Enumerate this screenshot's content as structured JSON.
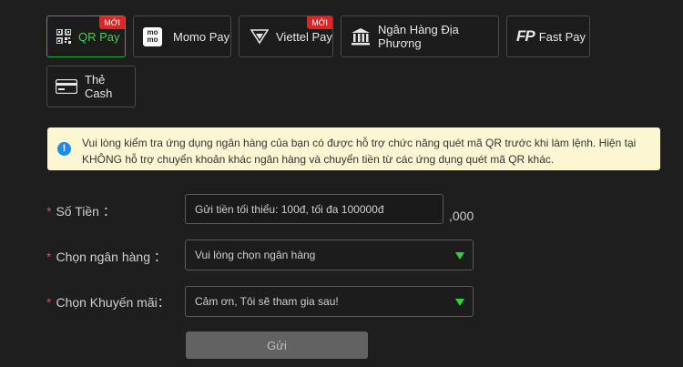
{
  "payment_methods": [
    {
      "label": "QR Pay",
      "badge": "MỚI"
    },
    {
      "label": "Momo Pay",
      "icon_text": "mo\nmo"
    },
    {
      "label": "Viettel Pay",
      "badge": "MỚI"
    },
    {
      "label": "Ngân Hàng Địa Phương"
    },
    {
      "label": "Fast Pay",
      "icon_text": "FP"
    },
    {
      "label": "Thẻ Cash"
    }
  ],
  "notice": {
    "text": "Vui lòng kiểm tra ứng dụng ngân hàng của bạn có được hỗ trợ chức năng quét mã QR trước khi làm lệnh. Hiện tại KHÔNG hỗ trợ chuyển khoản khác ngân hàng và chuyển tiền từ các ứng dụng quét mã QR khác."
  },
  "form": {
    "required_mark": "*",
    "amount": {
      "label": "Số Tiền ：",
      "placeholder": "Gửi tiền tối thiểu: 100đ, tối đa 100000đ",
      "suffix": ",000"
    },
    "bank": {
      "label": "Chọn ngân hàng ：",
      "value": "Vui lòng chọn ngân hàng"
    },
    "promo": {
      "label": "Chọn Khuyến mãi：",
      "value": "Cảm ơn, Tôi sẽ tham gia sau!"
    },
    "submit_label": "Gửi"
  },
  "colors": {
    "accent": "#2fd13f",
    "badge": "#e02424",
    "notice_bg": "#fdf6d2"
  }
}
